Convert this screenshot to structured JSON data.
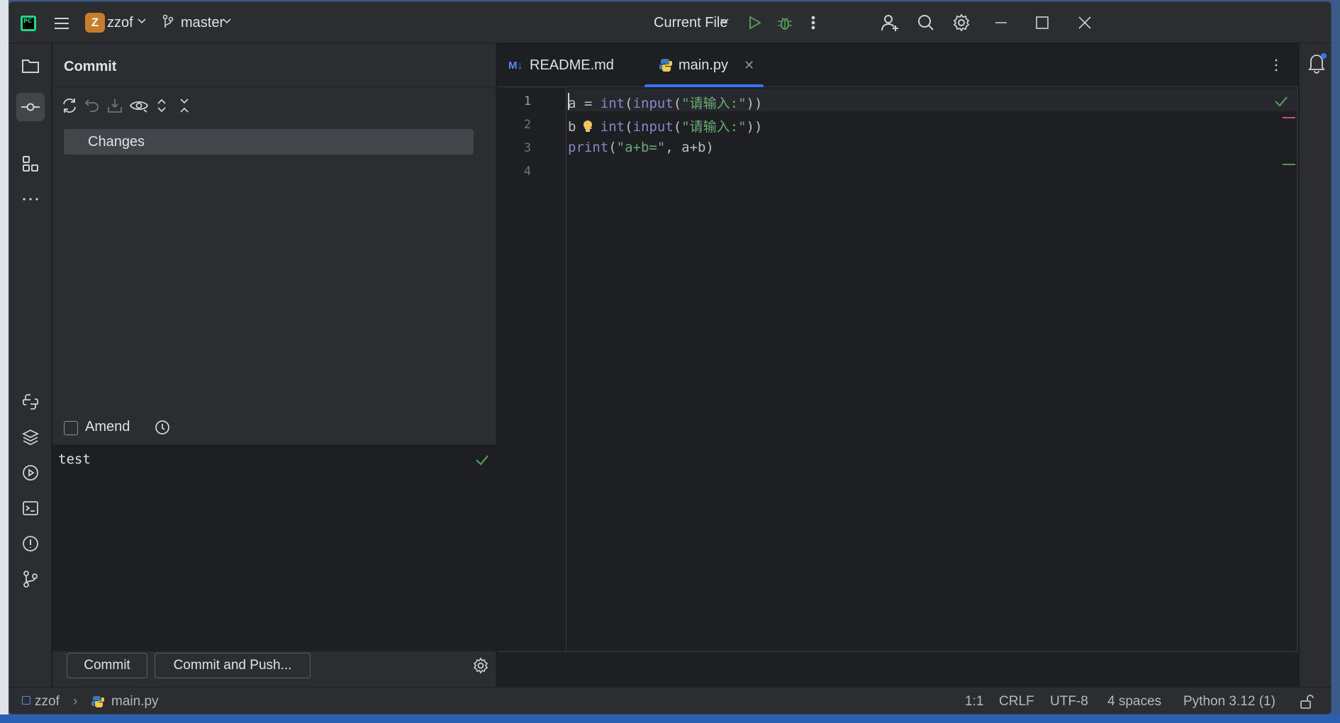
{
  "titlebar": {
    "project_initial": "Z",
    "project_name": "zzof",
    "branch": "master",
    "run_config": "Current File",
    "logo_text": "PC"
  },
  "commit_panel": {
    "title": "Commit",
    "changes_label": "Changes",
    "amend_label": "Amend",
    "amend_checked": false,
    "commit_message": "test",
    "commit_button": "Commit",
    "commit_push_button": "Commit and Push..."
  },
  "editor": {
    "tabs": [
      {
        "label": "README.md",
        "badge": "M↓",
        "active": false
      },
      {
        "label": "main.py",
        "active": true
      }
    ],
    "lines": [
      {
        "num": "1",
        "var": "a",
        "rest": " = int(input(\"请输入:\"))"
      },
      {
        "num": "2",
        "var": "b",
        "rest": " = int(input(\"请输入:\"))"
      },
      {
        "num": "3",
        "code": "print(\"a+b=\", a+b)"
      },
      {
        "num": "4",
        "code": ""
      }
    ]
  },
  "statusbar": {
    "project": "zzof",
    "file": "main.py",
    "position": "1:1",
    "line_ending": "CRLF",
    "encoding": "UTF-8",
    "indent": "4 spaces",
    "interpreter": "Python 3.12 (1)"
  },
  "colors": {
    "accent": "#3574f0",
    "string": "#6aab73",
    "builtin": "#8888c6",
    "panel_bg": "#2b2d30",
    "editor_bg": "#1e1f22"
  }
}
